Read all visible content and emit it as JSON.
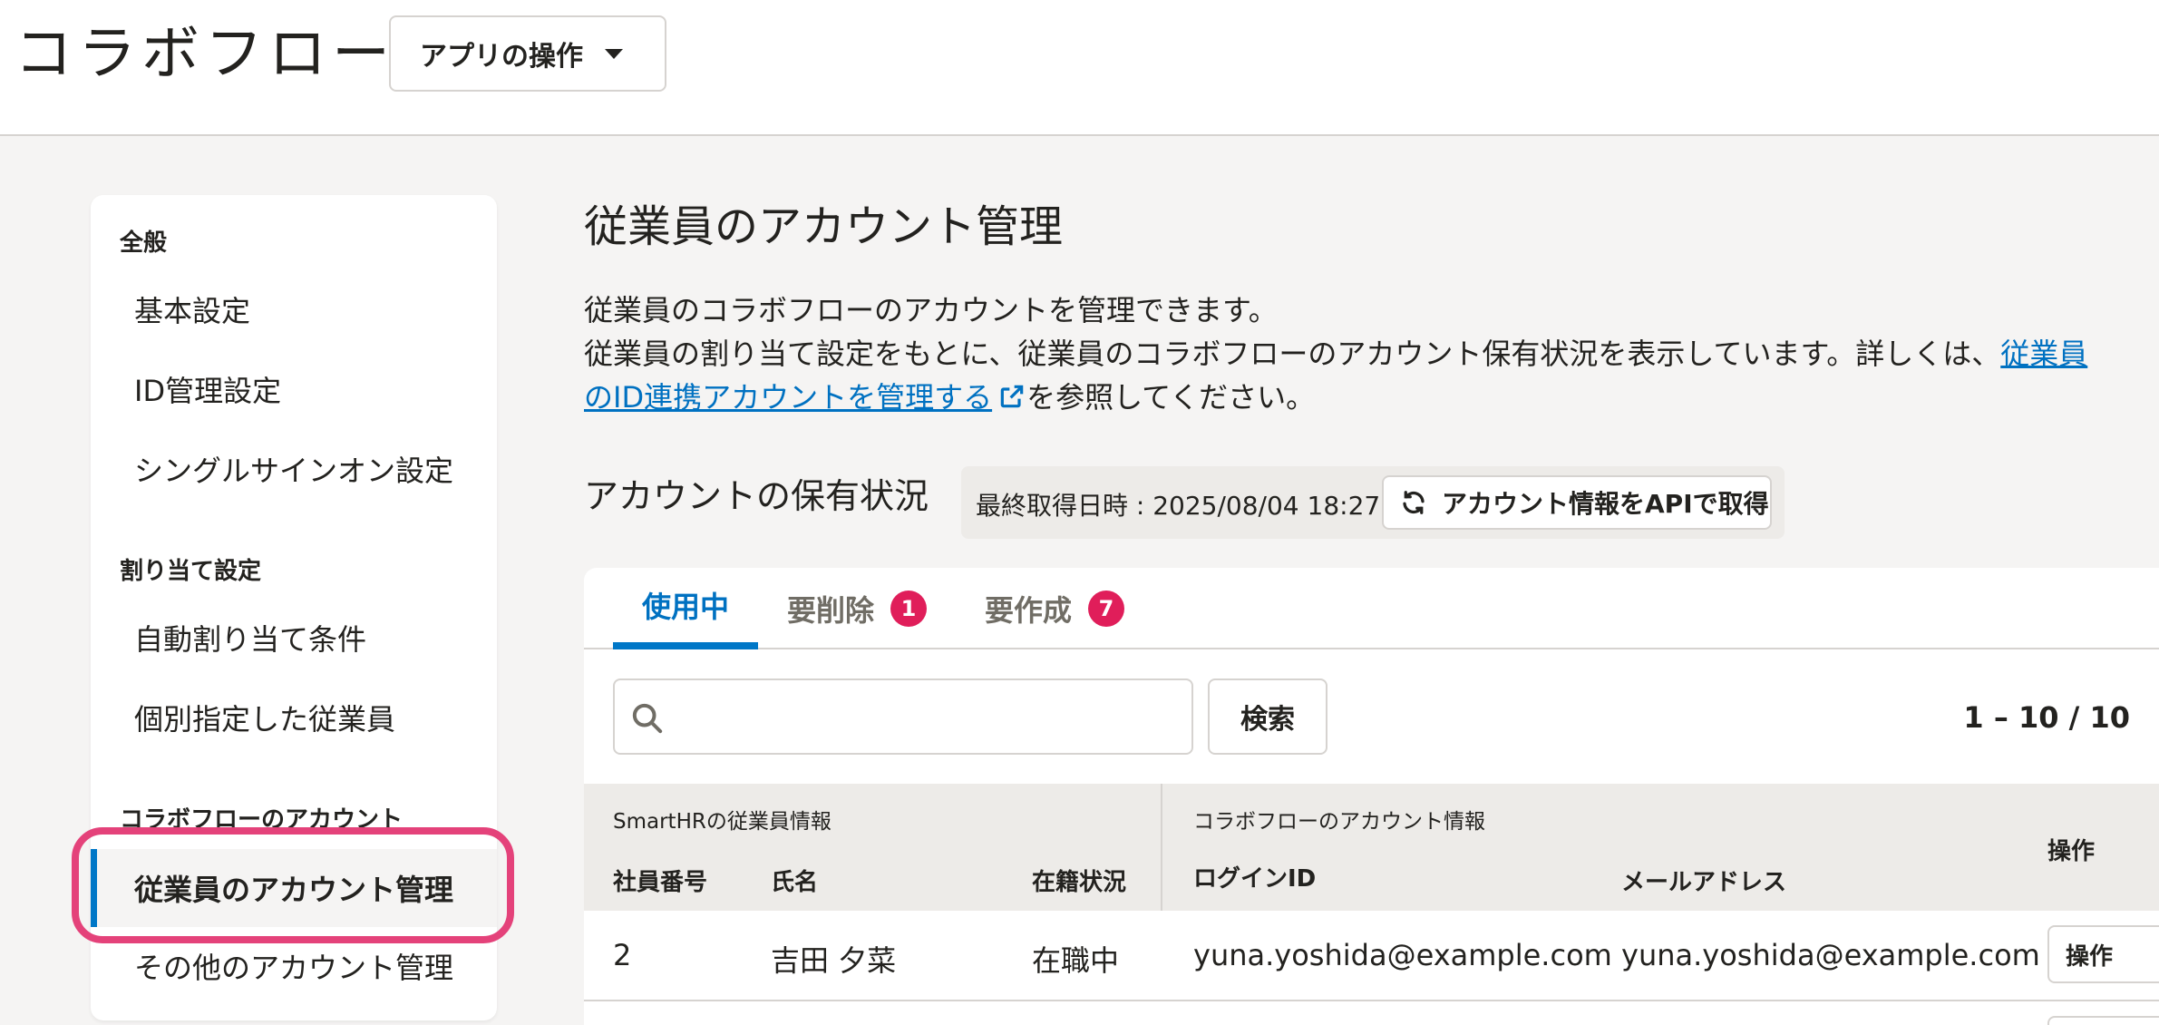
{
  "header": {
    "app_title": "コラボフロー",
    "app_ops_label": "アプリの操作"
  },
  "sidebar": {
    "sections": [
      {
        "title": "全般",
        "items": [
          "基本設定",
          "ID管理設定",
          "シングルサインオン設定"
        ]
      },
      {
        "title": "割り当て設定",
        "items": [
          "自動割り当て条件",
          "個別指定した従業員"
        ]
      },
      {
        "title": "コラボフローのアカウント",
        "items": [
          "従業員のアカウント管理",
          "その他のアカウント管理"
        ]
      }
    ],
    "active_item": "従業員のアカウント管理"
  },
  "main": {
    "title": "従業員のアカウント管理",
    "desc_line1": "従業員のコラボフローのアカウントを管理できます。",
    "desc_line2_prefix": "従業員の割り当て設定をもとに、従業員のコラボフローのアカウント保有状況を表示しています。詳しくは、",
    "desc_link": "従業員のID連携アカウントを管理する",
    "desc_suffix": "を参照してください。",
    "status_title": "アカウントの保有状況",
    "last_fetched": "最終取得日時 : 2025/08/04 18:27",
    "fetch_button": "アカウント情報をAPIで取得"
  },
  "tabs": [
    {
      "label": "使用中",
      "badge": ""
    },
    {
      "label": "要削除",
      "badge": "1"
    },
    {
      "label": "要作成",
      "badge": "7"
    }
  ],
  "search": {
    "placeholder": "",
    "button": "検索",
    "pager": "1 – 10 / 10"
  },
  "table": {
    "group_smarthr": "SmartHRの従業員情報",
    "group_collabo": "コラボフローのアカウント情報",
    "col_ops": "操作",
    "columns": [
      "社員番号",
      "氏名",
      "在籍状況",
      "ログインID",
      "メールアドレス"
    ],
    "rows": [
      {
        "emp_no": "2",
        "name": "吉田 夕菜",
        "status": "在職中",
        "login_id": "yuna.yoshida@example.com",
        "email": "yuna.yoshida@example.com",
        "op": "操作"
      }
    ]
  },
  "colors": {
    "accent": "#0077c7",
    "link": "#0071c1",
    "badge": "#e01e5a",
    "highlight": "#e4427a"
  }
}
